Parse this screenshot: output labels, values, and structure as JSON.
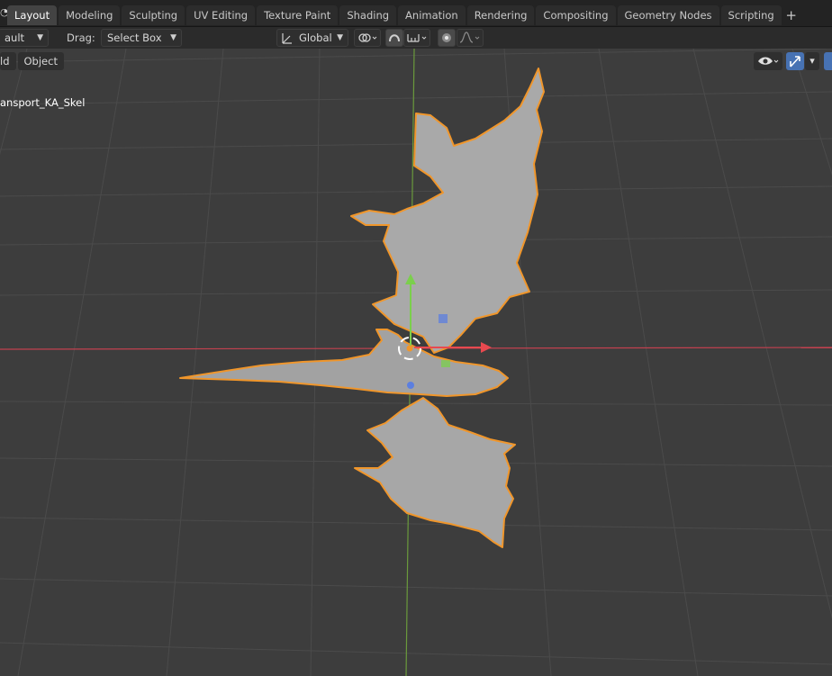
{
  "workspace_tabs": {
    "items": [
      {
        "label": "Layout",
        "active": true
      },
      {
        "label": "Modeling"
      },
      {
        "label": "Sculpting"
      },
      {
        "label": "UV Editing"
      },
      {
        "label": "Texture Paint"
      },
      {
        "label": "Shading"
      },
      {
        "label": "Animation"
      },
      {
        "label": "Rendering"
      },
      {
        "label": "Compositing"
      },
      {
        "label": "Geometry Nodes"
      },
      {
        "label": "Scripting"
      }
    ],
    "add_label": "+"
  },
  "header": {
    "orientation_value": "ault",
    "drag_label": "Drag:",
    "drag_value": "Select Box",
    "transform_orientation": "Global"
  },
  "viewport": {
    "mode_left_label": "ld",
    "object_menu_label": "Object",
    "active_object_name": "ansport_KA_Skel",
    "colors": {
      "background": "#3d3d3d",
      "grid": "#4b4b4b",
      "x_axis": "#c2414f",
      "y_axis": "#6a9a3c",
      "selection_outline": "#f0962b",
      "mesh": "#a8a8a8"
    }
  },
  "icons": [
    "transform-pivot-icon",
    "snap-icon",
    "proportional-edit-icon",
    "visibility-eye-icon",
    "gizmo-icon"
  ]
}
